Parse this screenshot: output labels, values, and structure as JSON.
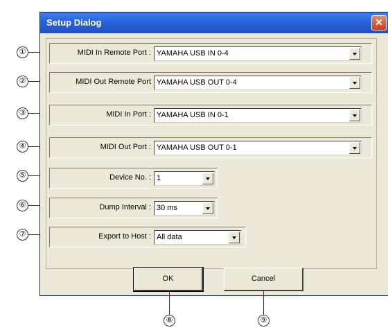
{
  "dialog": {
    "title": "Setup Dialog",
    "close_glyph": "✕"
  },
  "fields": [
    {
      "label": "MIDI In Remote Port :",
      "value": "YAMAHA USB IN 0-4"
    },
    {
      "label": "MIDI Out Remote Port",
      "value": "YAMAHA USB OUT 0-4"
    },
    {
      "label": "MIDI In Port :",
      "value": "YAMAHA USB IN 0-1"
    },
    {
      "label": "MIDI Out Port :",
      "value": "YAMAHA USB OUT 0-1"
    },
    {
      "label": "Device No. :",
      "value": "1"
    },
    {
      "label": "Dump Interval :",
      "value": "30 ms"
    },
    {
      "label": "Export to Host :",
      "value": "All data"
    }
  ],
  "buttons": {
    "ok": "OK",
    "cancel": "Cancel"
  },
  "callouts": [
    "①",
    "②",
    "③",
    "④",
    "⑤",
    "⑥",
    "⑦",
    "⑧",
    "⑨"
  ]
}
